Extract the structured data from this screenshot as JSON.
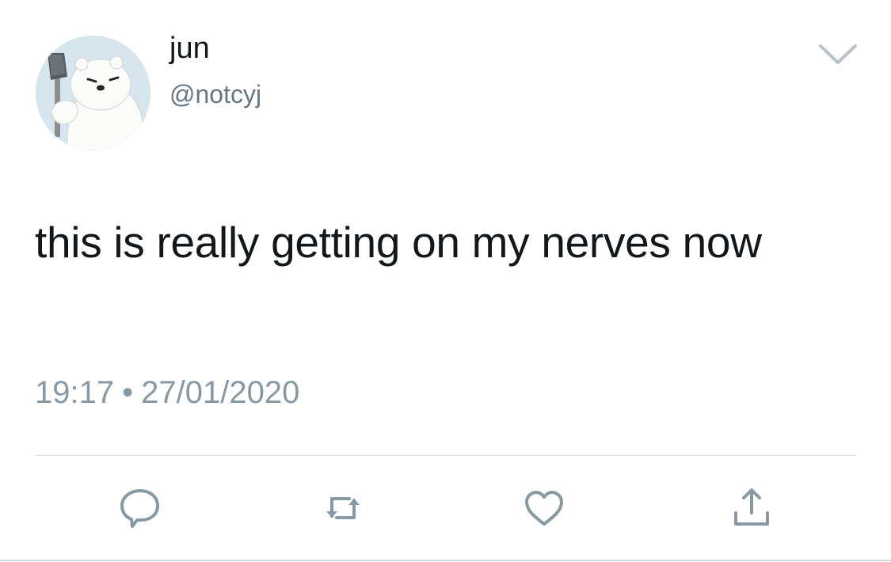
{
  "tweet": {
    "author": {
      "display_name": "jun",
      "handle": "@notcyj",
      "avatar": "polar-bear-with-axe-avatar"
    },
    "text": "this is really getting on my nerves now",
    "time": "19:17",
    "separator": "•",
    "date": "27/01/2020"
  },
  "actions": [
    {
      "name": "reply",
      "icon": "reply-icon"
    },
    {
      "name": "retweet",
      "icon": "retweet-icon"
    },
    {
      "name": "like",
      "icon": "heart-icon"
    },
    {
      "name": "share",
      "icon": "share-icon"
    }
  ],
  "colors": {
    "text": "#14171a",
    "secondary": "#657786",
    "meta": "#8899a6",
    "icon": "#8899a6",
    "divider": "#d8dfe4"
  }
}
